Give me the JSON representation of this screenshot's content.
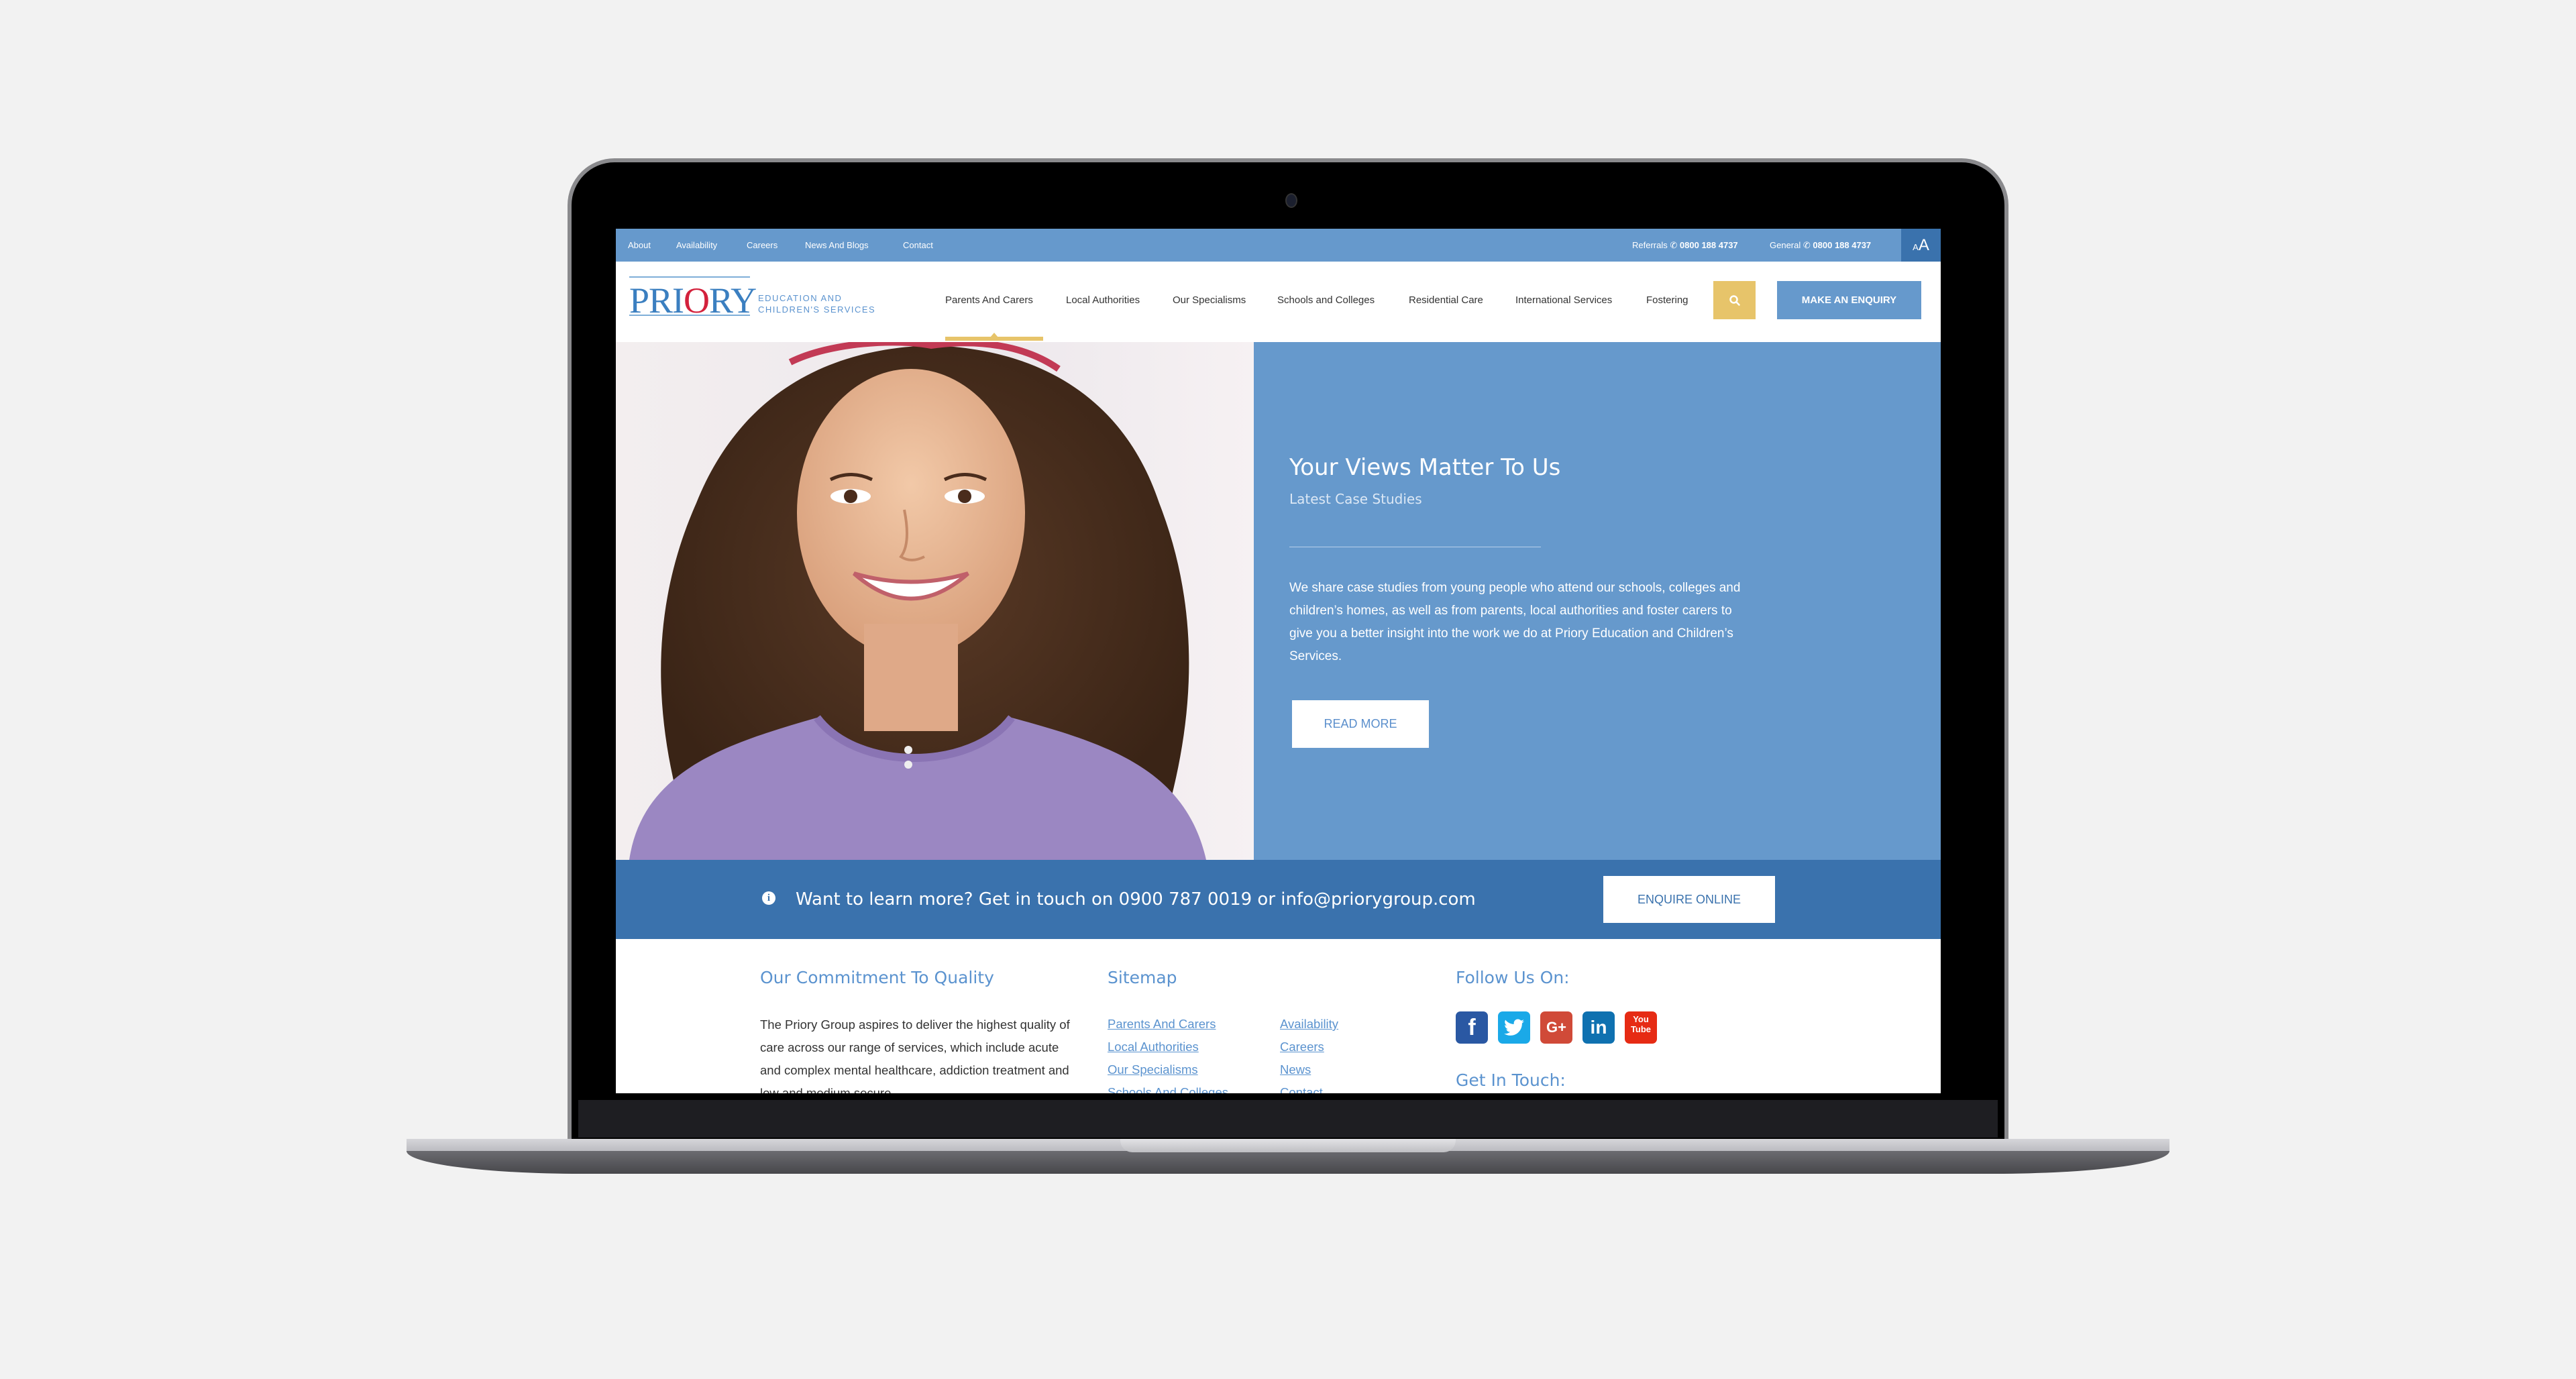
{
  "topbar": {
    "links": [
      "About",
      "Availability",
      "Careers",
      "News And Blogs",
      "Contact"
    ],
    "referrals_label": "Referrals",
    "referrals_phone": "0800 188 4737",
    "general_label": "General",
    "general_phone": "0800 188 4737",
    "text_size_small": "A",
    "text_size_large": "A"
  },
  "header": {
    "logo_word_a": "PRI",
    "logo_word_o": "O",
    "logo_word_b": "RY",
    "logo_sub_1": "EDUCATION AND",
    "logo_sub_2": "CHILDREN'S SERVICES",
    "nav": [
      "Parents And Carers",
      "Local Authorities",
      "Our Specialisms",
      "Schools and Colleges",
      "Residential Care",
      "International Services",
      "Fostering"
    ],
    "active_nav": "Parents And Carers",
    "search_icon": "search-icon",
    "enquiry_label": "MAKE AN ENQUIRY"
  },
  "hero": {
    "title": "Your Views Matter To Us",
    "subtitle": "Latest Case Studies",
    "body": "We share case studies from young people who attend our schools, colleges and children’s homes, as well as from parents, local authorities and foster carers to give you a better insight into the work we do at Priory Education and Children’s Services.",
    "read_more_label": "READ MORE"
  },
  "cta": {
    "info_icon": "i",
    "text": "Want to learn more? Get in touch on 0900 787 0019 or info@priorygroup.com",
    "button_label": "ENQUIRE ONLINE"
  },
  "footer": {
    "quality_heading": "Our Commitment To Quality",
    "quality_body": "The Priory Group aspires to deliver the highest quality of care across our range of services, which include acute and complex mental healthcare, addiction treatment and low and medium secure",
    "sitemap_heading": "Sitemap",
    "sitemap_col1": [
      "Parents And Carers",
      "Local Authorities",
      "Our Specialisms",
      "Schools And Colleges"
    ],
    "sitemap_col2": [
      "Availability",
      "Careers",
      "News",
      "Contact"
    ],
    "follow_heading": "Follow Us On:",
    "social": [
      {
        "name": "facebook",
        "glyph": "f",
        "color": "#2a58a3"
      },
      {
        "name": "twitter",
        "glyph": "🐦",
        "color": "#1aa9e8"
      },
      {
        "name": "google-plus",
        "glyph": "G+",
        "color": "#d04a38"
      },
      {
        "name": "linkedin",
        "glyph": "in",
        "color": "#0f71b0"
      },
      {
        "name": "youtube",
        "glyph": "You Tube",
        "color": "#e62b14"
      }
    ],
    "get_in_touch_heading": "Get In Touch:"
  },
  "colors": {
    "brand_blue": "#6699cc",
    "dark_blue": "#3a72ad",
    "accent_gold": "#e7c46a",
    "logo_red": "#d3213c"
  }
}
